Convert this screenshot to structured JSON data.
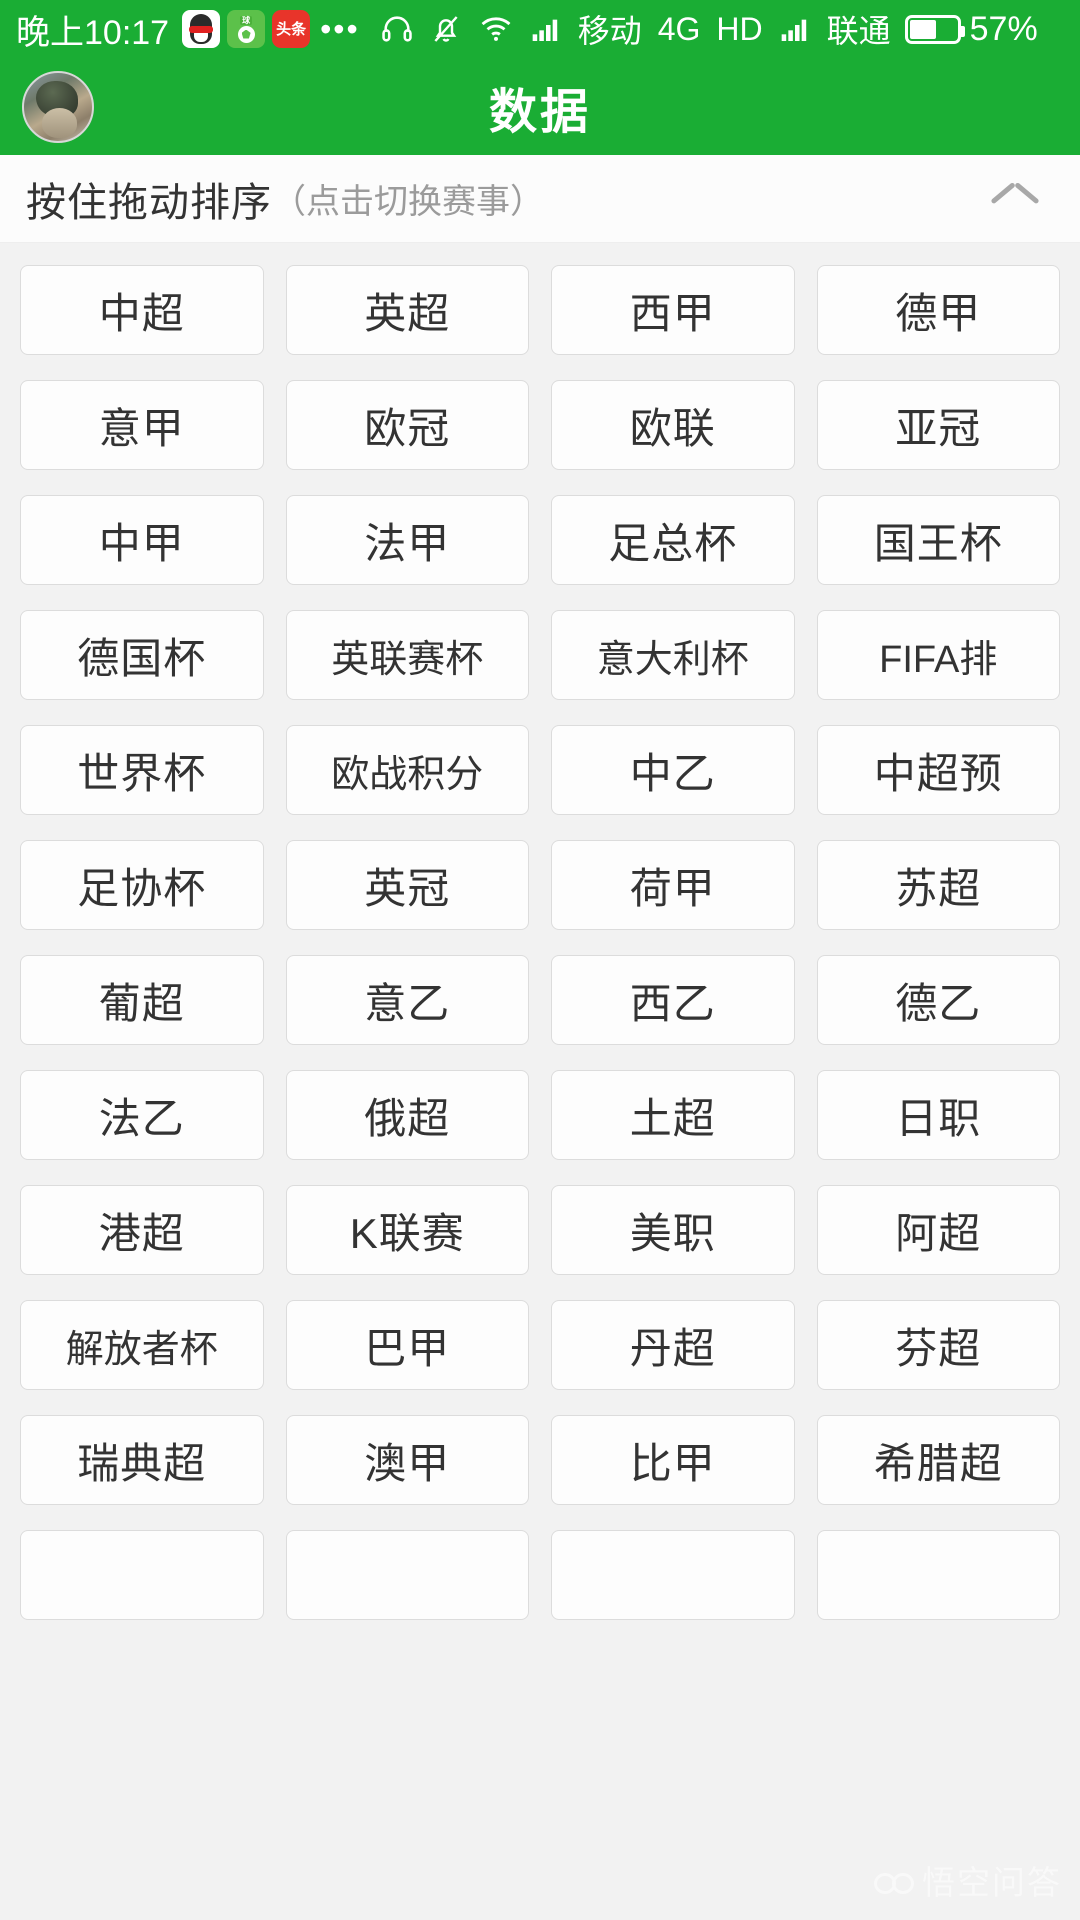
{
  "statusbar": {
    "clock": "晚上10:17",
    "app_icons": [
      {
        "name": "qq-app-icon",
        "label": "QQ"
      },
      {
        "name": "soccer-app-icon",
        "label": "球"
      },
      {
        "name": "toutiao-app-icon",
        "label": "头条"
      }
    ],
    "toutiao_line1": "头条",
    "overflow_dots": "•••",
    "icons": [
      "headset-icon",
      "bell-muted-icon",
      "wifi-icon",
      "signal-icon"
    ],
    "carrier_primary": "移动",
    "network_type": "4G",
    "hd_label": "HD",
    "carrier_secondary": "联通",
    "battery_percent": "57%",
    "battery_level": 57,
    "accent_color": "#1aad34"
  },
  "titlebar": {
    "title": "数据",
    "avatar_name": "user-avatar"
  },
  "sort_header": {
    "main_text": "按住拖动排序",
    "sub_text": "（点击切换赛事）",
    "collapse_icon": "chevron-up-icon"
  },
  "grid": {
    "columns": 4,
    "tiles": [
      "中超",
      "英超",
      "西甲",
      "德甲",
      "意甲",
      "欧冠",
      "欧联",
      "亚冠",
      "中甲",
      "法甲",
      "足总杯",
      "国王杯",
      "德国杯",
      "英联赛杯",
      "意大利杯",
      "FIFA排",
      "世界杯",
      "欧战积分",
      "中乙",
      "中超预",
      "足协杯",
      "英冠",
      "荷甲",
      "苏超",
      "葡超",
      "意乙",
      "西乙",
      "德乙",
      "法乙",
      "俄超",
      "土超",
      "日职",
      "港超",
      "K联赛",
      "美职",
      "阿超",
      "解放者杯",
      "巴甲",
      "丹超",
      "芬超",
      "瑞典超",
      "澳甲",
      "比甲",
      "希腊超",
      "",
      "",
      "",
      ""
    ]
  },
  "watermark": {
    "text": "悟空问答",
    "logo_name": "wukong-logo-icon"
  }
}
